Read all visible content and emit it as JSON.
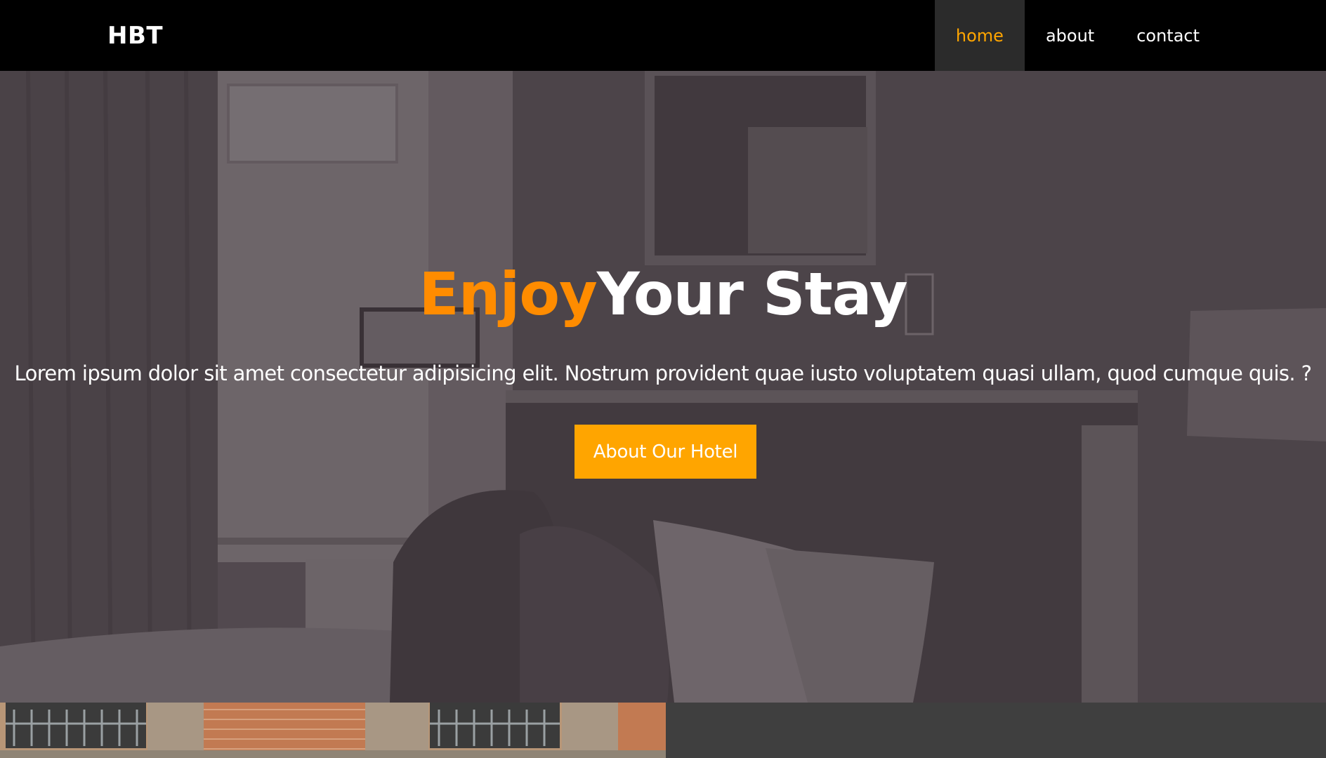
{
  "navbar": {
    "logo": "HBT",
    "links": [
      {
        "label": "home",
        "active": true
      },
      {
        "label": "about",
        "active": false
      },
      {
        "label": "contact",
        "active": false
      }
    ]
  },
  "hero": {
    "title_accent": "Enjoy",
    "title_rest": "Your Stay",
    "subtitle": "Lorem ipsum dolor sit amet consectetur adipisicing elit. Nostrum provident quae iusto voluptatem quasi ullam, quod cumque quis. ?",
    "button_label": "About Our Hotel"
  },
  "colors": {
    "accent": "#ffa500",
    "title_accent": "#ff8c00",
    "navbar_bg": "#000000",
    "active_nav_bg": "#2b2b2b",
    "bottom_panel": "#3f3f3f"
  },
  "images": {
    "hero_background": "hotel-bedroom-photo",
    "bottom_left": "building-facade-photo"
  }
}
